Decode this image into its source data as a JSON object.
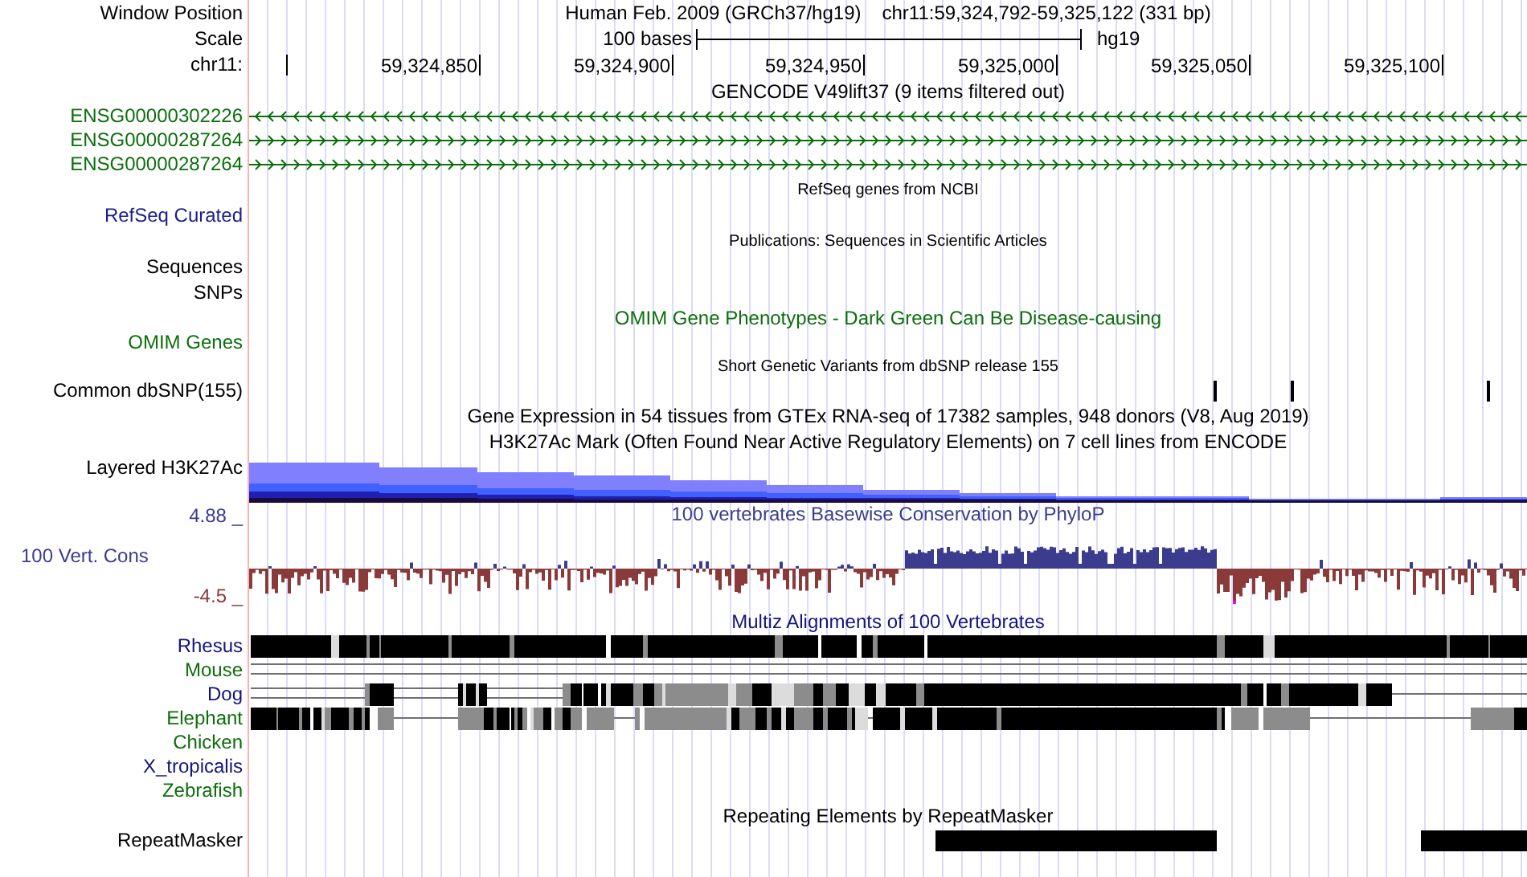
{
  "position": {
    "label": "Window Position",
    "assembly": "Human Feb. 2009 (GRCh37/hg19)",
    "range": "chr11:59,324,792-59,325,122 (331 bp)"
  },
  "scale": {
    "label": "Scale",
    "bar_label": "100 bases",
    "database": "hg19"
  },
  "ruler": {
    "label": "chr11:",
    "ticks": [
      "59,324,850",
      "59,324,900",
      "59,324,950",
      "59,325,000",
      "59,325,050",
      "59,325,100"
    ]
  },
  "tracks": [
    {
      "kind": "genes",
      "title": "GENCODE V49lift37 (9 items filtered out)",
      "items": [
        {
          "name": "ENSG00000302226",
          "kind": "reverse",
          "color": "#0a6e0a"
        },
        {
          "name": "ENSG00000287264",
          "kind": "forward",
          "color": "#0a6e0a"
        },
        {
          "name": "ENSG00000287264",
          "kind": "forward",
          "color": "#0a6e0a"
        }
      ]
    },
    {
      "kind": "blank",
      "title": "RefSeq genes from NCBI",
      "labels": [
        {
          "text": "RefSeq Curated",
          "color": "#1c1c8c"
        }
      ]
    },
    {
      "kind": "blank",
      "title": "Publications: Sequences in Scientific Articles",
      "labels": [
        {
          "text": "Sequences"
        },
        {
          "text": "SNPs"
        }
      ]
    },
    {
      "kind": "phenotype",
      "title": "OMIM Gene Phenotypes - Dark Green Can Be Disease-causing",
      "color": "#0c6e0c",
      "labels": [
        {
          "text": "OMIM Genes",
          "color": "#0c6e0c"
        }
      ]
    },
    {
      "kind": "variants",
      "title": "Short Genetic Variants from dbSNP release 155",
      "labels": [
        {
          "text": "Common dbSNP(155)"
        }
      ]
    },
    {
      "kind": "heading",
      "title": "Gene Expression in 54 tissues from GTEx RNA-seq of 17382 samples, 948 donors (V8, Aug 2019)"
    },
    {
      "kind": "density",
      "title": "H3K27Ac Mark (Often Found Near Active Regulatory Elements) on 7 cell lines from ENCODE",
      "labels": [
        {
          "text": "Layered H3K27Ac"
        }
      ]
    },
    {
      "kind": "wiggle",
      "title": "100 vertebrates Basewise Conservation by PhyloP",
      "color": "#3c3c8f",
      "labels": [
        {
          "text": "100 Vert. Cons",
          "color": "#3c3c8f"
        }
      ],
      "axis": {
        "max": {
          "text": "4.88 _",
          "color": "#3c3c8f"
        },
        "min": {
          "text": "-4.5 _",
          "color": "#8b3a3a"
        }
      }
    },
    {
      "kind": "alignment",
      "title": "Multiz Alignments of 100 Vertebrates",
      "color": "#14147a",
      "species": [
        {
          "name": "Rhesus",
          "color": "#14147a"
        },
        {
          "name": "Mouse",
          "color": "#0c6e0c"
        },
        {
          "name": "Dog",
          "color": "#14147a"
        },
        {
          "name": "Elephant",
          "color": "#0c6e0c"
        },
        {
          "name": "Chicken",
          "color": "#0c6e0c"
        },
        {
          "name": "X_tropicalis",
          "color": "#14147a"
        },
        {
          "name": "Zebrafish",
          "color": "#0c6e0c"
        }
      ]
    },
    {
      "kind": "repeats",
      "title": "Repeating Elements by RepeatMasker",
      "labels": [
        {
          "text": "RepeatMasker"
        }
      ]
    }
  ]
}
